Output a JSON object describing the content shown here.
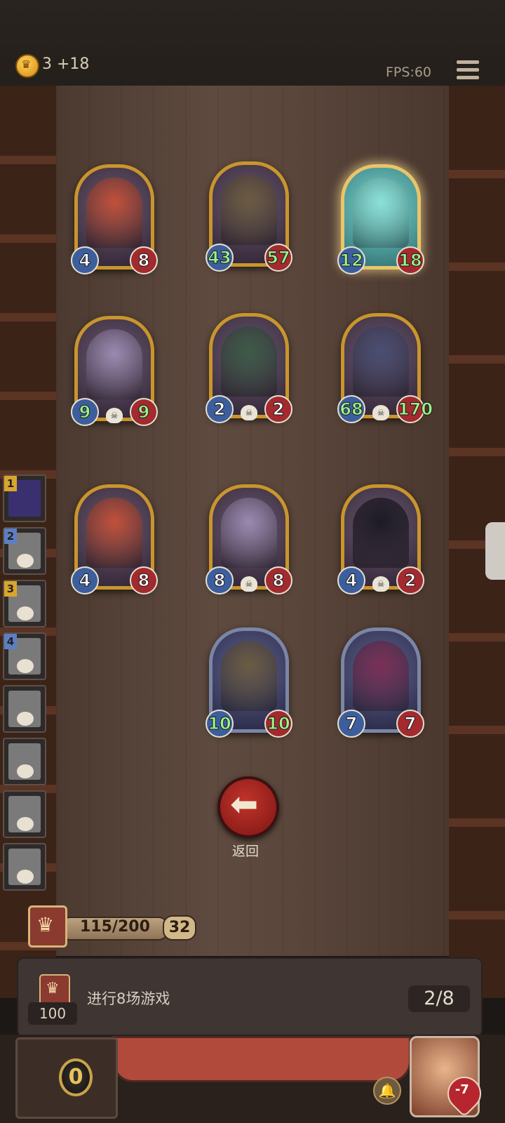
{
  "topbar": {
    "coins": "3 +18",
    "fps": "FPS:60"
  },
  "board_cards": [
    {
      "attack": "4",
      "health": "8",
      "portrait_color": "#c0503a",
      "style": "gold"
    },
    {
      "attack": "43",
      "health": "57",
      "portrait_color": "#6b5b42",
      "style": "gold",
      "green": true
    },
    {
      "attack": "12",
      "health": "18",
      "portrait_color": "#8ce0d8",
      "style": "glow",
      "green": true
    },
    {
      "attack": "9",
      "health": "9",
      "portrait_color": "#9a8ab0",
      "style": "gold",
      "green": true
    },
    {
      "attack": "2",
      "health": "2",
      "portrait_color": "#3d5a48",
      "style": "gold"
    },
    {
      "attack": "68",
      "health": "170",
      "portrait_color": "#4a4e72",
      "style": "gold",
      "green": true
    },
    {
      "attack": "4",
      "health": "8",
      "portrait_color": "#c0503a",
      "style": "gold"
    },
    {
      "attack": "8",
      "health": "8",
      "portrait_color": "#9a8ab0",
      "style": "gold"
    },
    {
      "attack": "4",
      "health": "2",
      "portrait_color": "#1c1a24",
      "style": "gold"
    },
    {
      "attack": "10",
      "health": "10",
      "portrait_color": "#6b5b42",
      "style": "silver",
      "green": true
    },
    {
      "attack": "7",
      "health": "7",
      "portrait_color": "#7a2f55",
      "style": "silver"
    }
  ],
  "tier_list": [
    {
      "num": "1",
      "color": "#d9a62c"
    },
    {
      "num": "2",
      "color": "#5d7fc2"
    },
    {
      "num": "3",
      "color": "#d9a62c"
    },
    {
      "num": "4",
      "color": "#5d7fc2"
    },
    {
      "num": "",
      "color": ""
    },
    {
      "num": "",
      "color": ""
    },
    {
      "num": "",
      "color": ""
    },
    {
      "num": "",
      "color": ""
    }
  ],
  "back_button": {
    "label": "返回"
  },
  "progress": {
    "text": "115/200",
    "badge": "32"
  },
  "quest": {
    "reward": "100",
    "text": "进行8场游戏",
    "progress": "2/8"
  },
  "bottom": {
    "coins": "0",
    "hero_health": "-7"
  }
}
